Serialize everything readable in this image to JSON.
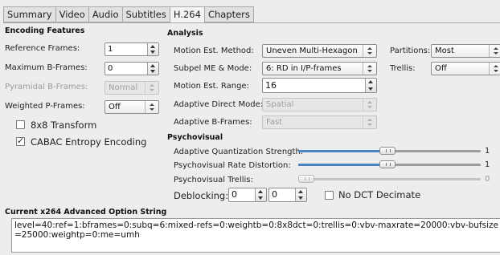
{
  "tabs": [
    {
      "label": "Summary",
      "active": false
    },
    {
      "label": "Video",
      "active": false
    },
    {
      "label": "Audio",
      "active": false
    },
    {
      "label": "Subtitles",
      "active": false
    },
    {
      "label": "H.264",
      "active": true
    },
    {
      "label": "Chapters",
      "active": false
    }
  ],
  "encoding_features": {
    "heading": "Encoding Features",
    "reference_frames": {
      "label": "Reference Frames:",
      "value": "1"
    },
    "max_bframes": {
      "label": "Maximum B-Frames:",
      "value": "0"
    },
    "pyramidal_bframes": {
      "label": "Pyramidal B-Frames:",
      "value": "Normal",
      "disabled": true
    },
    "weighted_pframes": {
      "label": "Weighted P-Frames:",
      "value": "Off"
    },
    "transform_8x8": {
      "label": "8x8 Transform",
      "checked": false
    },
    "cabac": {
      "label": "CABAC Entropy Encoding",
      "checked": true
    }
  },
  "analysis": {
    "heading": "Analysis",
    "motion_est_method": {
      "label": "Motion Est. Method:",
      "value": "Uneven Multi-Hexagon"
    },
    "subpel_me": {
      "label": "Subpel ME & Mode:",
      "value": "6: RD in I/P-frames"
    },
    "motion_est_range": {
      "label": "Motion Est. Range:",
      "value": "16"
    },
    "adaptive_direct_mode": {
      "label": "Adaptive Direct Mode:",
      "value": "Spatial",
      "disabled": true
    },
    "adaptive_bframes": {
      "label": "Adaptive B-Frames:",
      "value": "Fast",
      "disabled": true
    },
    "partitions": {
      "label": "Partitions:",
      "value": "Most"
    },
    "trellis": {
      "label": "Trellis:",
      "value": "Off"
    }
  },
  "psychovisual": {
    "heading": "Psychovisual",
    "aq_strength": {
      "label": "Adaptive Quantization Strength:",
      "value": "1",
      "level": 0.5
    },
    "rd_strength": {
      "label": "Psychovisual Rate Distortion:",
      "value": "1",
      "level": 0.5
    },
    "psy_trellis": {
      "label": "Psychovisual Trellis:",
      "value": "0",
      "level": 0.0,
      "disabled": true
    },
    "deblocking": {
      "label": "Deblocking:",
      "value1": "0",
      "value2": "0"
    },
    "no_dct_decimate": {
      "label": "No DCT Decimate",
      "checked": false
    }
  },
  "option_string": {
    "heading": "Current x264 Advanced Option String",
    "value": "level=40:ref=1:bframes=0:subq=6:mixed-refs=0:weightb=0:8x8dct=0:trellis=0:vbv-maxrate=20000:vbv-bufsize=25000:weightp=0:me=umh"
  },
  "colors": {
    "slider_fill": "#4a84c4",
    "background": "#ededed"
  }
}
